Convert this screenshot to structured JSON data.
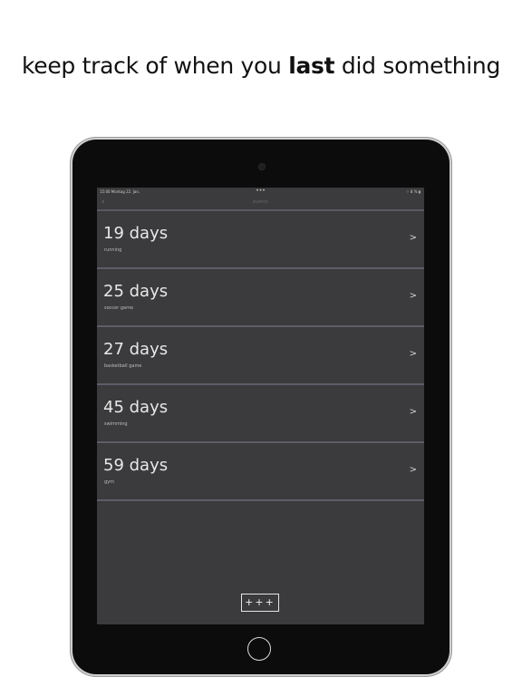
{
  "headline": {
    "before": "keep track of when you ",
    "emphasis": "last",
    "after": " did something"
  },
  "statusbar": {
    "time_date": "15:00  Montag 22. Jan.",
    "center": "•••",
    "right": "⌔ 8 % ▮"
  },
  "navbar": {
    "back_icon": "‹",
    "title": "events"
  },
  "items": [
    {
      "days": "19 days",
      "activity": "running"
    },
    {
      "days": "25 days",
      "activity": "soccer game"
    },
    {
      "days": "27 days",
      "activity": "basketball game"
    },
    {
      "days": "45 days",
      "activity": "swimming"
    },
    {
      "days": "59 days",
      "activity": "gym"
    }
  ],
  "chevron": ">",
  "add_button": "+++",
  "icons": {
    "back": "chevron-left-icon",
    "row": "chevron-right-icon",
    "home": "home-button-icon",
    "camera": "camera-icon"
  }
}
